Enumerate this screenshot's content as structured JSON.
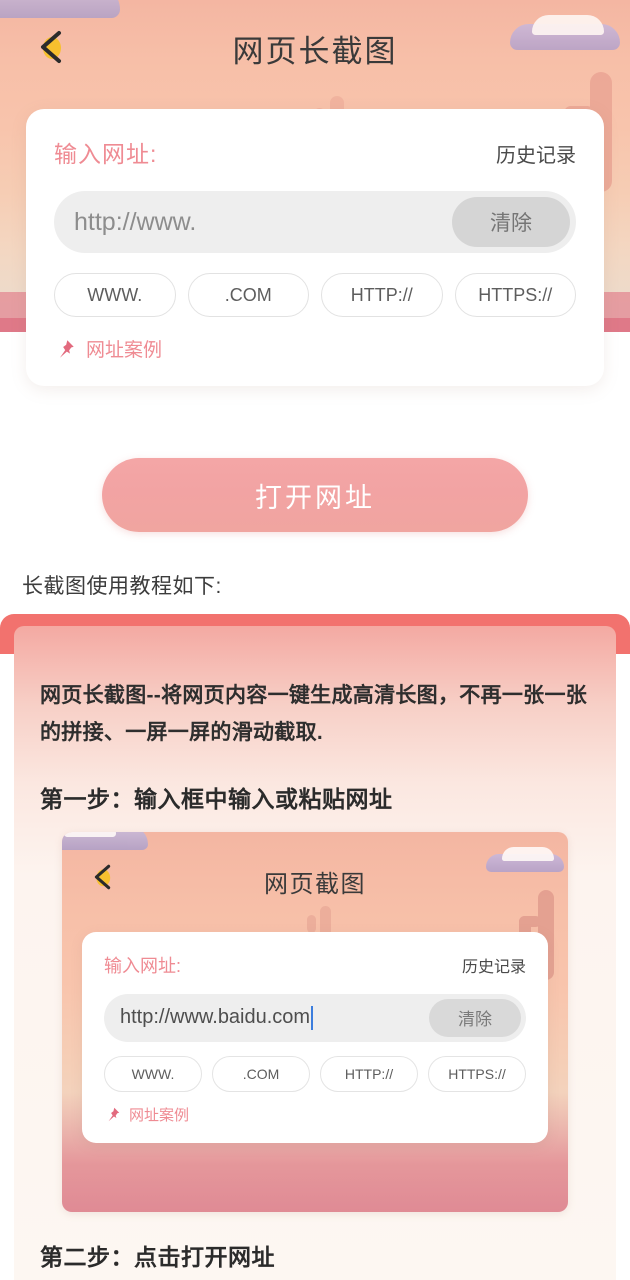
{
  "header": {
    "title": "网页长截图",
    "back_icon": "chevron-left-icon"
  },
  "input_card": {
    "label": "输入网址:",
    "history_label": "历史记录",
    "url_placeholder": "http://www.",
    "url_value": "",
    "clear_label": "清除",
    "chips": [
      "WWW.",
      ".COM",
      "HTTP://",
      "HTTPS://"
    ],
    "case_icon": "pushpin-icon",
    "case_label": "网址案例"
  },
  "open_button": {
    "label": "打开网址"
  },
  "tutorial": {
    "heading": "长截图使用教程如下:",
    "intro": "网页长截图--将网页内容一键生成高清长图，不再一张一张的拼接、一屏一屏的滑动截取.",
    "step1_title": "第一步：输入框中输入或粘贴网址",
    "step2_title": "第二步：点击打开网址",
    "embedded": {
      "title": "网页截图",
      "back_icon": "chevron-left-icon",
      "label": "输入网址:",
      "history_label": "历史记录",
      "url_value": "http://www.baidu.com",
      "clear_label": "清除",
      "chips": [
        "WWW.",
        ".COM",
        "HTTP://",
        "HTTPS://"
      ],
      "case_icon": "pushpin-icon",
      "case_label": "网址案例"
    }
  },
  "colors": {
    "accent_pink": "#ef8b93",
    "hero_top": "#f4b6a2",
    "button_pink": "#f2a3a3",
    "tutorial_bar": "#f2726e",
    "caret_blue": "#3b7ddd"
  }
}
